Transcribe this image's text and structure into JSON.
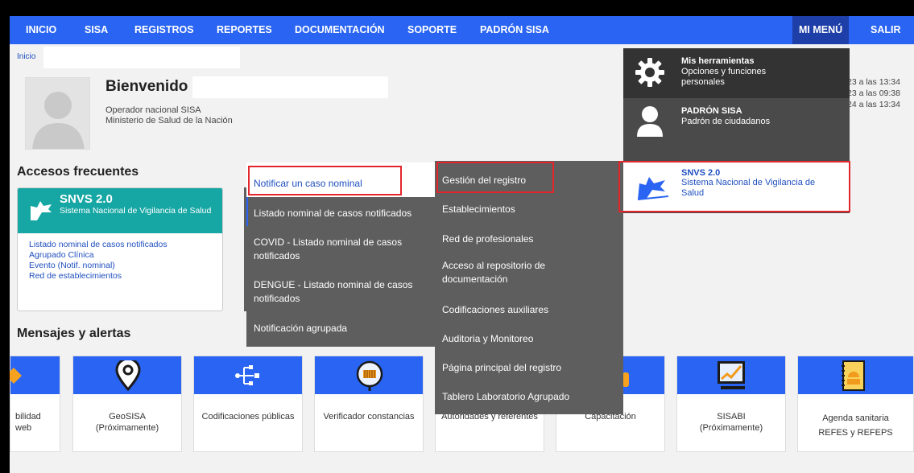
{
  "nav": {
    "items": [
      "INICIO",
      "SISA",
      "REGISTROS",
      "REPORTES",
      "DOCUMENTACIÓN",
      "SOPORTE",
      "PADRÓN SISA"
    ],
    "mi_menu": "MI MENÚ",
    "salir": "SALIR"
  },
  "breadcrumb": "Inicio",
  "profile": {
    "greeting": "Bienvenido",
    "role": "Operador nacional SISA",
    "org": "Ministerio de Salud de la Nación"
  },
  "accesos": {
    "title": "Accesos frecuentes",
    "card_title": "SNVS 2.0",
    "card_subtitle": "Sistema Nacional de Vigilancia de Salud",
    "links": [
      "Listado nominal de casos notificados",
      "Agrupado Clínica",
      "Evento (Notif. nominal)",
      "Red de establecimientos"
    ]
  },
  "mensajes": {
    "title": "Mensajes y alertas"
  },
  "tiles": [
    {
      "label": "bilidad\nweb"
    },
    {
      "label": "GeoSISA\n(Próximamente)"
    },
    {
      "label": "Codificaciones públicas"
    },
    {
      "label": "Verificador constancias"
    },
    {
      "label": "Autoridades y referentes"
    },
    {
      "label": "Capacitación"
    },
    {
      "label": "SISABI\n(Próximamente)"
    },
    {
      "label": "Agenda sanitaria\nREFES y REFEPS"
    }
  ],
  "menu_snvs": [
    "Notificar un caso nominal",
    "Listado nominal de casos notificados",
    "COVID - Listado nominal de casos notificados",
    "DENGUE - Listado nominal de casos notificados",
    "Notificación agrupada"
  ],
  "menu_registros": [
    "Gestión del registro",
    "Establecimientos",
    "Red de profesionales",
    "Acceso al repositorio de documentación",
    "Codificaciones auxiliares",
    "Auditoria y Monitoreo",
    "Página principal del registro",
    "Tablero Laboratorio Agrupado"
  ],
  "mi_menu_panel": {
    "herramientas_title": "Mis herramientas",
    "herramientas_sub": "Opciones y funciones personales",
    "padron_title": "PADRÓN SISA",
    "padron_sub": "Padrón de ciudadanos",
    "snvs_title": "SNVS 2.0",
    "snvs_sub": "Sistema Nacional de Vigilancia de Salud"
  },
  "login_times": [
    "23 a las 13:34",
    "23 a las 09:38",
    "24 a las 13:34"
  ],
  "colors": {
    "nav": "#2a64f2",
    "teal": "#16a7a4",
    "menu": "#5e5e5e",
    "highlight": "#e3262b"
  }
}
